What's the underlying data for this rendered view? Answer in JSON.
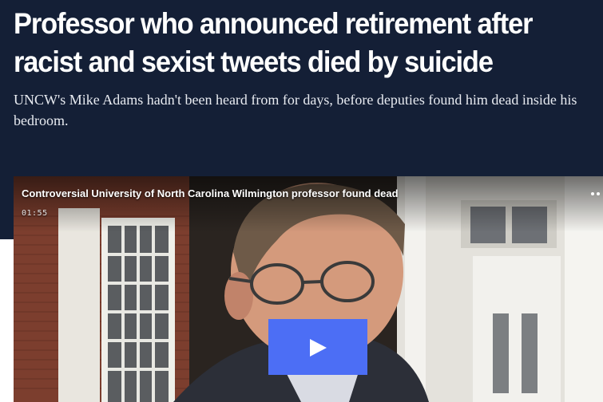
{
  "article": {
    "headline_line1": "Professor who announced retirement after",
    "headline_line2": "racist and sexist tweets died by suicide",
    "dek": "UNCW's Mike Adams hadn't been heard from for days, before deputies found him dead inside his bedroom."
  },
  "video": {
    "title": "Controversial University of North Carolina Wilmington professor found dead",
    "duration": "01:55",
    "play_icon": "play-icon",
    "more_icon": "more-dots-icon"
  },
  "colors": {
    "hero_background": "#141f36",
    "play_button": "#4c6ef5",
    "headline_text": "#ffffff"
  }
}
